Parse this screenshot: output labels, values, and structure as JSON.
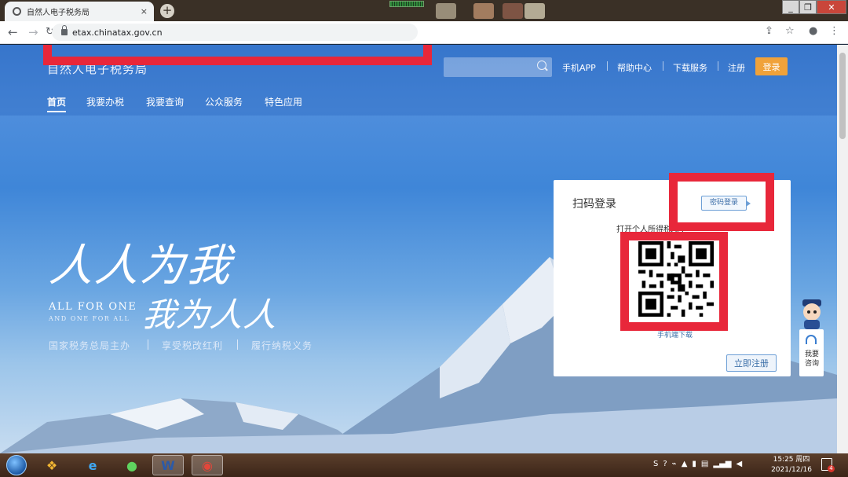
{
  "browser": {
    "tab_title": "自然人电子税务局",
    "tab_close": "×",
    "new_tab": "+",
    "url": "etax.chinatax.gov.cn",
    "window_controls": [
      "_",
      "❐",
      "✕"
    ],
    "icons": [
      "back-icon",
      "forward-icon",
      "reload-icon",
      "lock-icon",
      "share-icon",
      "star-icon",
      "profile-icon",
      "menu-icon"
    ]
  },
  "header": {
    "site_title": "自然人电子税务局",
    "search_placeholder": "",
    "links": [
      "手机APP",
      "帮助中心",
      "下载服务",
      "注册"
    ],
    "login": "登录"
  },
  "nav": {
    "items": [
      "首页",
      "我要办税",
      "我要查询",
      "公众服务",
      "特色应用"
    ],
    "active_index": 0
  },
  "hero": {
    "slogan_cn_1": "人人为我",
    "slogan_en_1": "ALL FOR ONE",
    "slogan_en_2": "AND ONE FOR ALL",
    "slogan_cn_2": "我为人人",
    "mottos": [
      "国家税务总局主办",
      "享受税改红利",
      "履行纳税义务"
    ]
  },
  "login_card": {
    "title": "扫码登录",
    "password_tab": "密码登录",
    "scan_hint": "打开个人所得税APP",
    "app_download": "手机端下载",
    "register": "立即注册"
  },
  "consult": {
    "label": "我要咨询"
  },
  "taskbar": {
    "apps": [
      "windows-start-icon",
      "explorer-icon",
      "ie-icon",
      "qq-browser-icon",
      "word-icon",
      "chrome-icon"
    ],
    "time": "15:25 周四",
    "date": "2021/12/16",
    "notifications": "4"
  },
  "colors": {
    "annotation": "#e8273a",
    "login_button": "#f0a23a",
    "accent_blue": "#3b6fa8"
  }
}
